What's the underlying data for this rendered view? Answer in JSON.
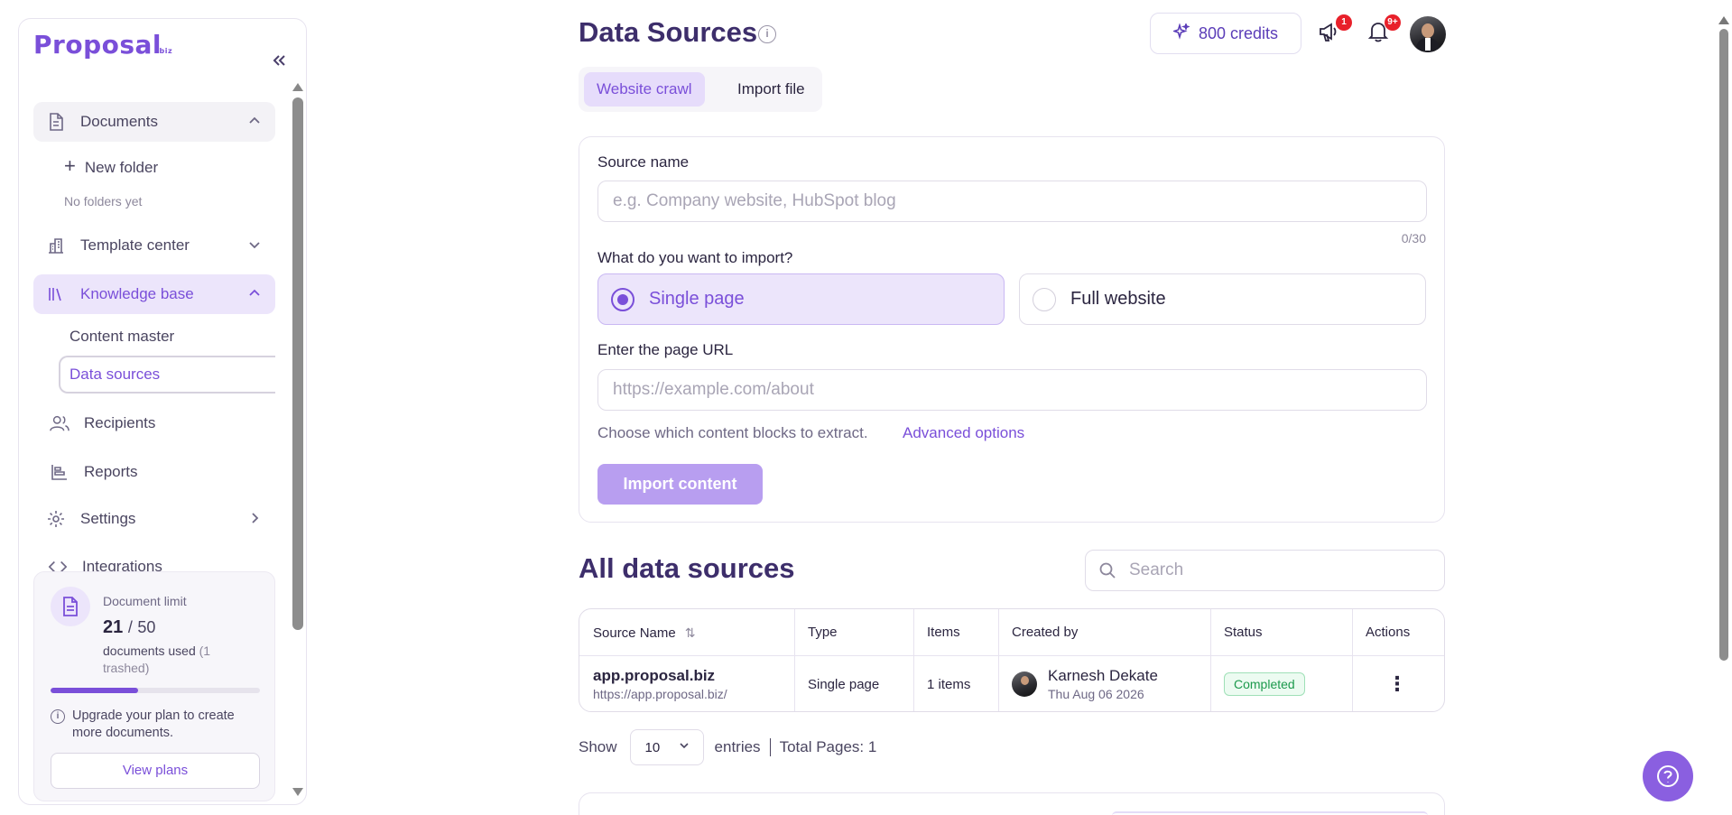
{
  "app": {
    "logo_text": "Proposal",
    "logo_suffix": ".biz"
  },
  "sidebar": {
    "documents": {
      "label": "Documents"
    },
    "new_folder": {
      "label": "New folder"
    },
    "no_folders": "No folders yet",
    "template_center": {
      "label": "Template center"
    },
    "knowledge_base": {
      "label": "Knowledge base"
    },
    "content_master": {
      "label": "Content master"
    },
    "data_sources": {
      "label": "Data sources"
    },
    "recipients": {
      "label": "Recipients"
    },
    "reports": {
      "label": "Reports"
    },
    "settings": {
      "label": "Settings"
    },
    "integrations": {
      "label": "Integrations"
    },
    "limit": {
      "title": "Document limit",
      "used": "21",
      "slash": "/",
      "max": "50",
      "used_label": "documents used",
      "trashed": "(1 trashed)",
      "progress_fraction": 0.42,
      "upgrade_text": "Upgrade your plan to create more documents.",
      "view_plans": "View plans"
    }
  },
  "header": {
    "title": "Data Sources",
    "credits": "800 credits",
    "announcements_badge": "1",
    "notifications_badge": "9+"
  },
  "tabs": [
    {
      "label": "Website crawl",
      "active": true
    },
    {
      "label": "Import file",
      "active": false
    }
  ],
  "form": {
    "source_name_label": "Source name",
    "source_name_placeholder": "e.g. Company website, HubSpot blog",
    "source_name_counter": "0/30",
    "import_question": "What do you want to import?",
    "option_single": "Single page",
    "option_full": "Full website",
    "url_label": "Enter the page URL",
    "url_placeholder": "https://example.com/about",
    "hint": "Choose which content blocks to extract.",
    "advanced": "Advanced options",
    "import_button": "Import content"
  },
  "list": {
    "title": "All data sources",
    "search_placeholder": "Search",
    "columns": [
      "Source Name",
      "Type",
      "Items",
      "Created by",
      "Status",
      "Actions"
    ],
    "rows": [
      {
        "name": "app.proposal.biz",
        "url": "https://app.proposal.biz/",
        "type": "Single page",
        "items": "1 items",
        "creator": "Karnesh Dekate",
        "date": "Thu Aug 06 2026",
        "status": "Completed"
      }
    ],
    "show_label": "Show",
    "page_size": "10",
    "entries_label": "entries",
    "total_pages": "Total Pages: 1"
  },
  "colors": {
    "accent": "#7a4fd9",
    "title": "#3d2e6b",
    "status_green": "#1d9a4d",
    "badge_red": "#e8202a"
  },
  "icons": [
    "document-icon",
    "plus-icon",
    "template-icon",
    "library-icon",
    "users-icon",
    "reports-icon",
    "gear-icon",
    "code-icon",
    "sparkle-icon",
    "megaphone-icon",
    "bell-icon",
    "search-icon",
    "help-icon",
    "kebab-icon",
    "info-icon"
  ]
}
